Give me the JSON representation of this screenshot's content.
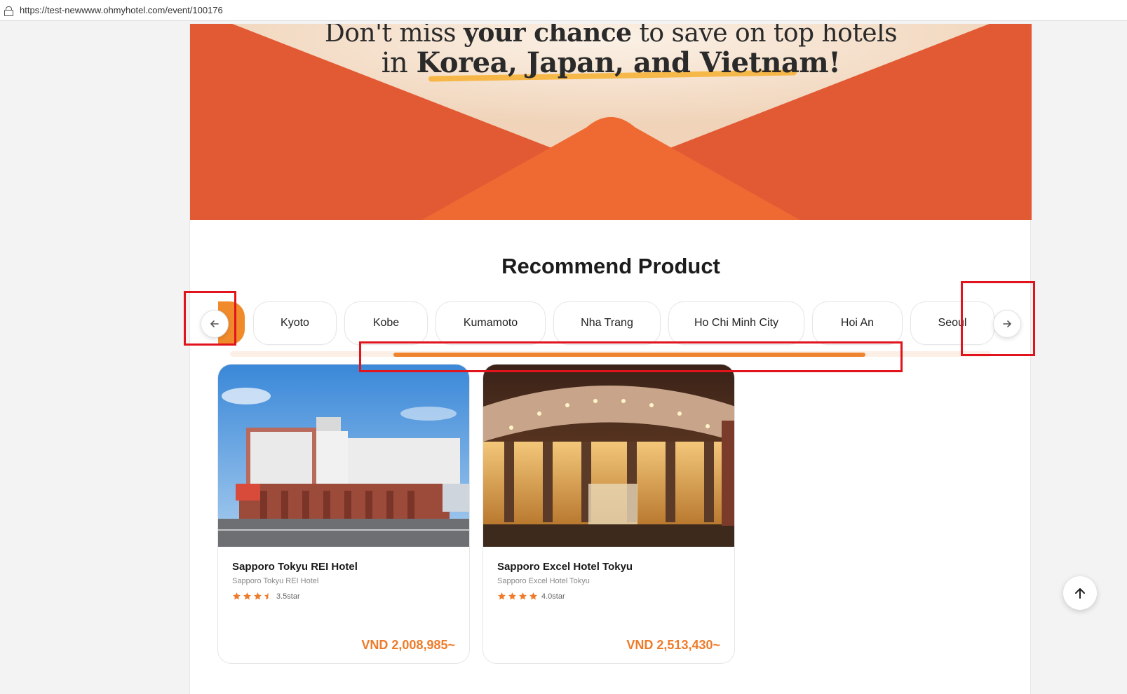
{
  "browser": {
    "url": "https://test-newwww.ohmyhotel.com/event/100176"
  },
  "hero": {
    "line1_pre": "Don't miss ",
    "line1_bold": "your chance",
    "line1_post": " to save on top hotels",
    "line2_pre": "in ",
    "line2_bold": "Korea, Japan, and Vietnam!"
  },
  "section": {
    "title": "Recommend Product"
  },
  "tabs": [
    {
      "label": "Kyoto"
    },
    {
      "label": "Kobe"
    },
    {
      "label": "Kumamoto"
    },
    {
      "label": "Nha Trang"
    },
    {
      "label": "Ho Chi Minh City"
    },
    {
      "label": "Hoi An"
    },
    {
      "label": "Seoul"
    }
  ],
  "nav": {
    "prev_icon": "arrow-left-icon",
    "next_icon": "arrow-right-icon"
  },
  "products": [
    {
      "name": "Sapporo Tokyu REI Hotel",
      "subname": "Sapporo Tokyu REI Hotel",
      "stars": 3.5,
      "rating_text": "3.5star",
      "price": "VND 2,008,985~"
    },
    {
      "name": "Sapporo Excel Hotel Tokyu",
      "subname": "Sapporo Excel Hotel Tokyu",
      "stars": 4,
      "rating_text": "4.0star",
      "price": "VND 2,513,430~"
    }
  ],
  "colors": {
    "brand_orange": "#ee7b2a",
    "hero_red": "#e25a34",
    "annotation_red": "#e1141d"
  }
}
